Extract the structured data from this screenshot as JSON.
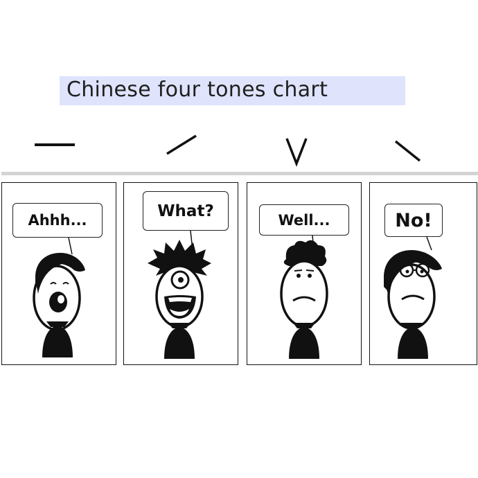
{
  "title": "Chinese four tones chart",
  "tones": [
    {
      "mark": "flat",
      "speech": "Ahhh..."
    },
    {
      "mark": "rising",
      "speech": "What?"
    },
    {
      "mark": "dipping",
      "speech": "Well..."
    },
    {
      "mark": "falling",
      "speech": "No!"
    }
  ],
  "colors": {
    "title_background": "#dfe3fb",
    "separator": "#d3d3d3",
    "ink": "#111111"
  }
}
